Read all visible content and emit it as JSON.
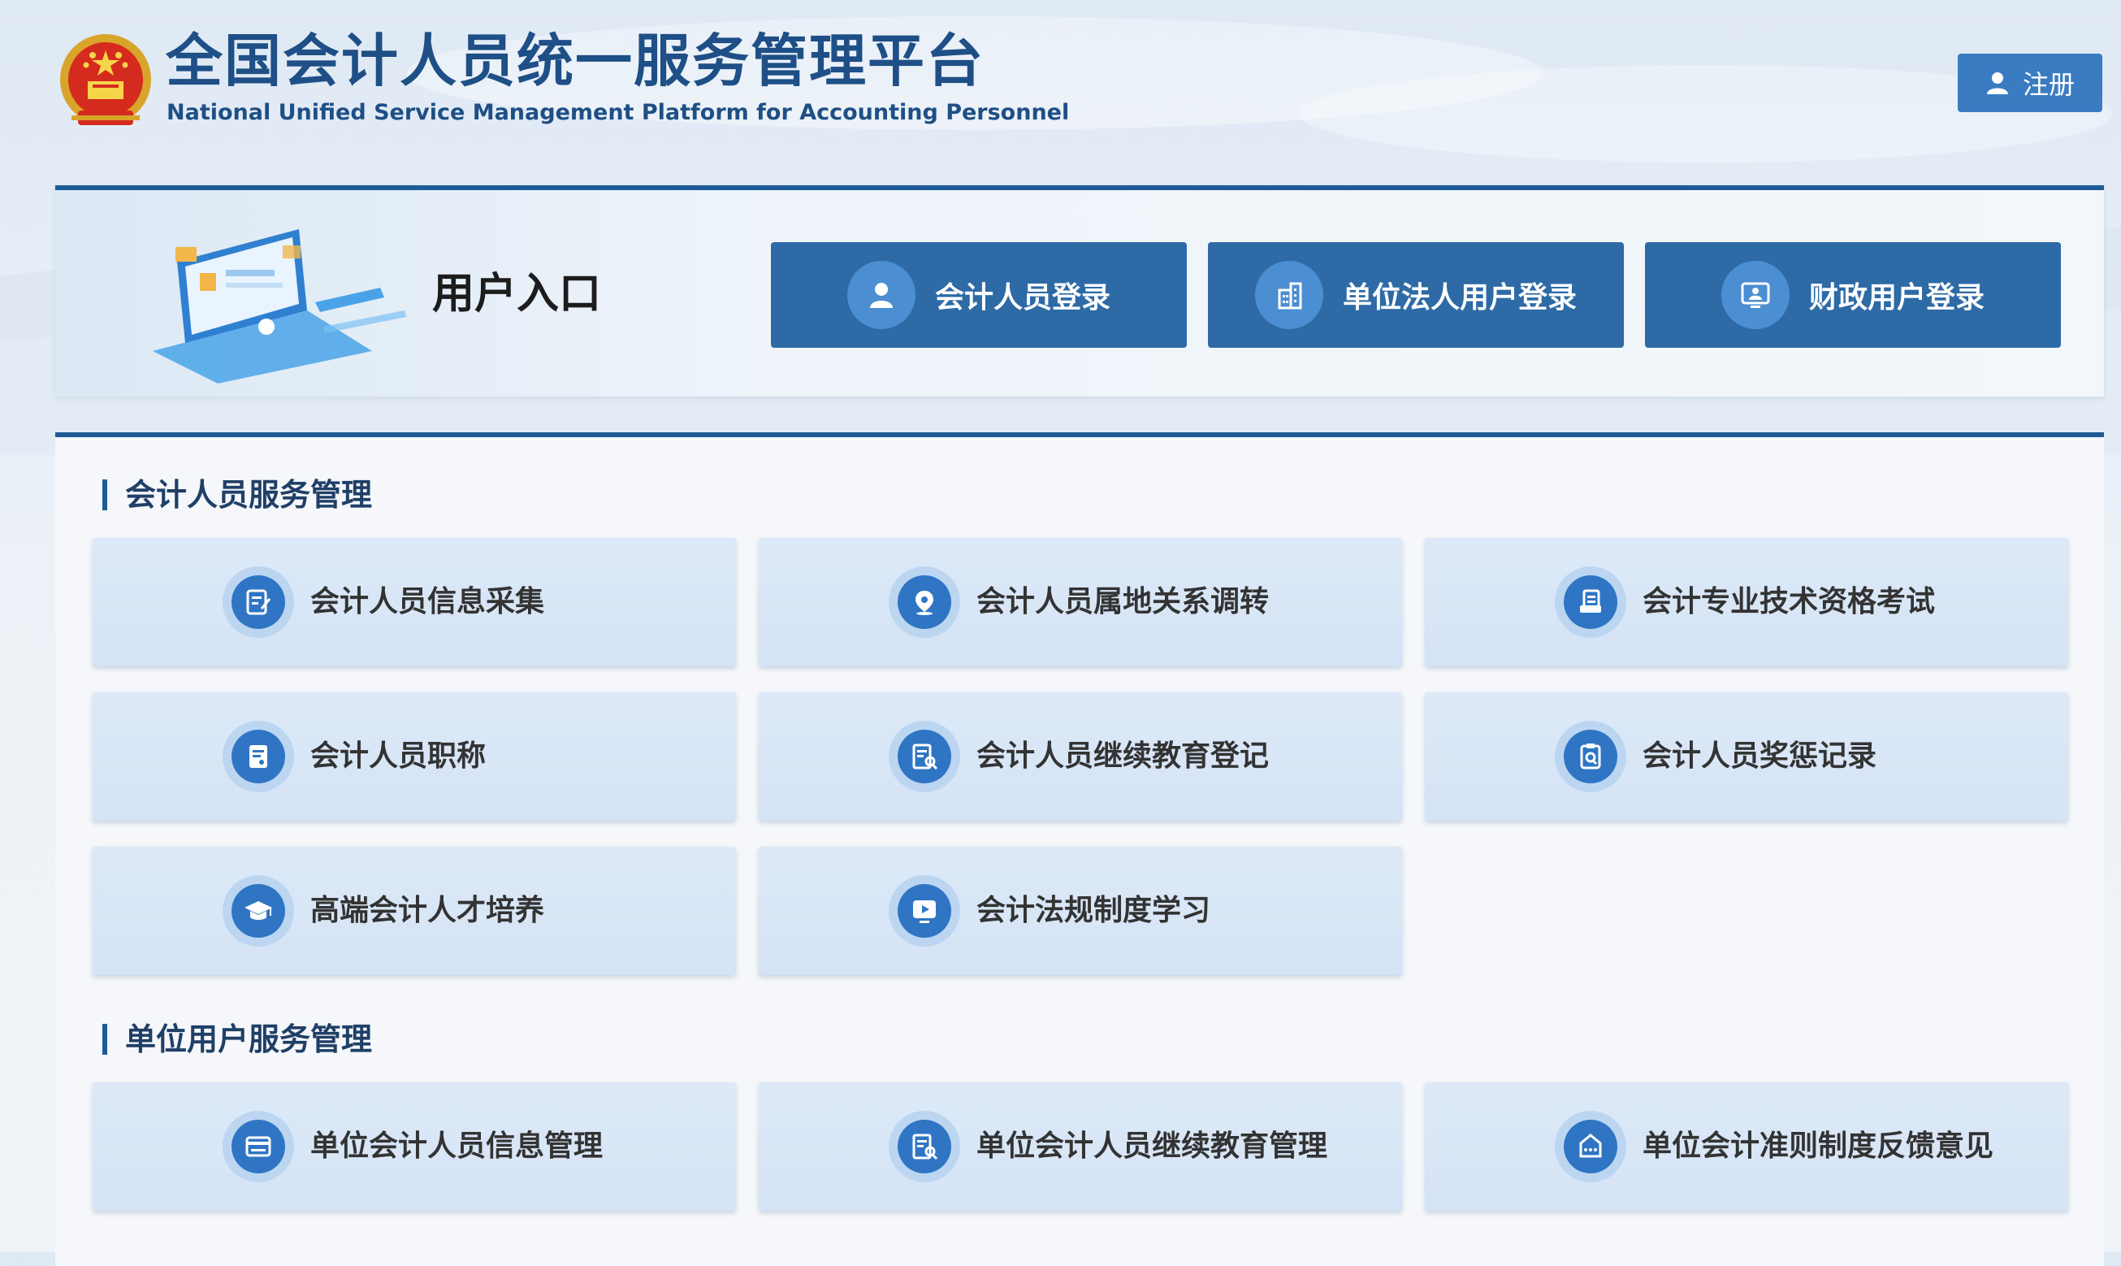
{
  "header": {
    "title": "全国会计人员统一服务管理平台",
    "subtitle": "National Unified Service Management Platform for Accounting Personnel",
    "register_label": "注册"
  },
  "login": {
    "title": "用户入口",
    "buttons": [
      {
        "label": "会计人员登录",
        "icon": "person-icon"
      },
      {
        "label": "单位法人用户登录",
        "icon": "building-icon"
      },
      {
        "label": "财政用户登录",
        "icon": "monitor-user-icon"
      }
    ]
  },
  "services": {
    "accountant": {
      "heading": "会计人员服务管理",
      "items": [
        {
          "label": "会计人员信息采集",
          "icon": "form-edit-icon"
        },
        {
          "label": "会计人员属地关系调转",
          "icon": "location-pin-icon"
        },
        {
          "label": "会计专业技术资格考试",
          "icon": "document-stack-icon"
        },
        {
          "label": "会计人员职称",
          "icon": "certificate-icon"
        },
        {
          "label": "会计人员继续教育登记",
          "icon": "document-search-icon"
        },
        {
          "label": "会计人员奖惩记录",
          "icon": "clipboard-search-icon"
        },
        {
          "label": "高端会计人才培养",
          "icon": "graduation-cap-icon"
        },
        {
          "label": "会计法规制度学习",
          "icon": "video-play-icon"
        }
      ]
    },
    "unit": {
      "heading": "单位用户服务管理",
      "items": [
        {
          "label": "单位会计人员信息管理",
          "icon": "id-card-icon"
        },
        {
          "label": "单位会计人员继续教育管理",
          "icon": "document-search-icon"
        },
        {
          "label": "单位会计准则制度反馈意见",
          "icon": "feedback-icon"
        }
      ]
    }
  },
  "colors": {
    "primary": "#2d6aa6",
    "accent": "#3a7cc2",
    "title": "#1e4f86",
    "card_bg": "#d9e7f7"
  }
}
